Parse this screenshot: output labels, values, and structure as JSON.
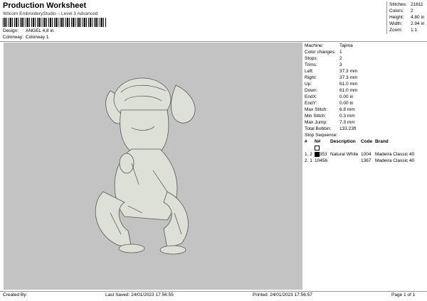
{
  "header": {
    "title": "Production Worksheet",
    "subtitle": "Wilcom EmbroideryStudio – Level 3 Advanced"
  },
  "design": {
    "design_label": "Design:",
    "design_value": "ANGEL 4,8 in",
    "colorway_label": "Colorway:",
    "colorway_value": "Colorway 1"
  },
  "stats": [
    {
      "label": "Stitches:",
      "value": "21811"
    },
    {
      "label": "Colors:",
      "value": "2"
    },
    {
      "label": "Height:",
      "value": "4.80 in"
    },
    {
      "label": "Width:",
      "value": "2.94 in"
    },
    {
      "label": "Zoom:",
      "value": "1:1"
    }
  ],
  "machine": [
    {
      "label": "Machine:",
      "value": "Tajima"
    },
    {
      "label": "Color changes:",
      "value": "1"
    },
    {
      "label": "Stops:",
      "value": "2"
    },
    {
      "label": "Trims:",
      "value": "3"
    },
    {
      "label": "Left:",
      "value": "37.3 mm"
    },
    {
      "label": "Right:",
      "value": "37.3 mm"
    },
    {
      "label": "Up:",
      "value": "61.0 mm"
    },
    {
      "label": "Down:",
      "value": "61.0 mm"
    },
    {
      "label": "EndX:",
      "value": "0.00 in"
    },
    {
      "label": "EndY:",
      "value": "0.00 in"
    },
    {
      "label": "Max Stitch:",
      "value": "6.8 mm"
    },
    {
      "label": "Min Stitch:",
      "value": "0.3 mm"
    },
    {
      "label": "Max Jump:",
      "value": "7.3 mm"
    },
    {
      "label": "Total Bobbin:",
      "value": "133.23ft"
    }
  ],
  "sequence": {
    "title": "Stop Sequence:",
    "headers": [
      "#",
      "N#",
      "Description",
      "Code",
      "Brand"
    ],
    "rows": [
      {
        "num": "1.",
        "stop": "2",
        "n": "11353",
        "color": "#ffffff",
        "description": "Natural White",
        "code": "1004",
        "brand": "Madeira Classic 40"
      },
      {
        "num": "2.",
        "stop": "1",
        "n": "10456",
        "color": "#000000",
        "description": "",
        "code": "1367",
        "brand": "Madeira Classic 40"
      }
    ]
  },
  "footer": {
    "created": "Created By:",
    "saved": "Last Saved: 24/01/2023 17:56:55",
    "printed": "Printed: 24/01/2023 17:56:57",
    "page": "Page 1 of 1"
  }
}
